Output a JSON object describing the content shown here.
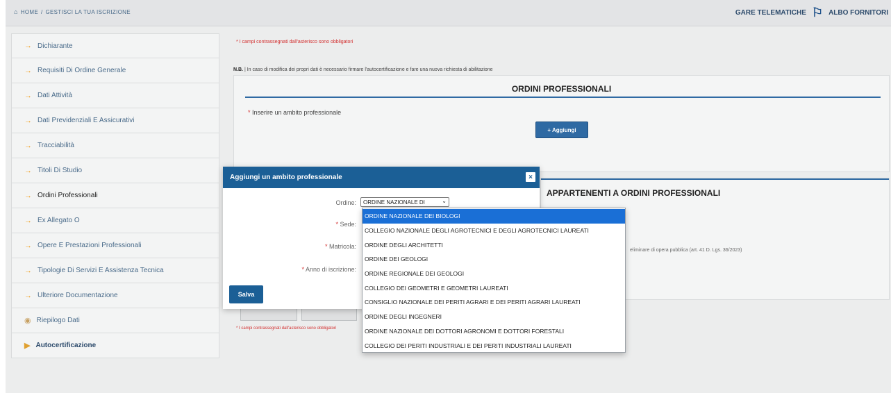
{
  "breadcrumb": {
    "home": "HOME",
    "separator": "/",
    "current": "GESTISCI LA TUA ISCRIZIONE"
  },
  "top_links": {
    "gare": "GARE TELEMATICHE",
    "albo": "ALBO FORNITORI"
  },
  "sidebar": {
    "items": [
      {
        "label": "Dichiarante"
      },
      {
        "label": "Requisiti Di Ordine Generale"
      },
      {
        "label": "Dati Attività"
      },
      {
        "label": "Dati Previdenziali E Assicurativi"
      },
      {
        "label": "Tracciabilità"
      },
      {
        "label": "Titoli Di Studio"
      },
      {
        "label": "Ordini Professionali"
      },
      {
        "label": "Ex Allegato O"
      },
      {
        "label": "Opere E Prestazioni Professionali"
      },
      {
        "label": "Tipologie Di Servizi E Assistenza Tecnica"
      },
      {
        "label": "Ulteriore Documentazione"
      },
      {
        "label": "Riepilogo Dati"
      },
      {
        "label": "Autocertificazione"
      }
    ]
  },
  "main": {
    "required_note": "* I campi contrassegnati dall'asterisco sono obbligatori",
    "nb_prefix": "N.B.",
    "nb_text": "In caso di modifica dei propri dati è necessario firmare l'autocertificazione e fare una nuova richiesta di abilitazione",
    "panel_title": "ORDINI PROFESSIONALI",
    "panel_label": "Inserire un ambito professionale",
    "add_button": "+ Aggiungi",
    "panel2_title": "APPARTENENTI A ORDINI PROFESSIONALI",
    "panel2_text": "eliminare di opera pubblica (art. 41 D. Lgs. 36/2023)",
    "bottom_note": "* I campi contrassegnati dall'asterisco sono obbligatori"
  },
  "modal": {
    "title": "Aggiungi un ambito professionale",
    "close": "×",
    "fields": {
      "ordine": "Ordine:",
      "sede": "Sede:",
      "matricola": "Matricola:",
      "anno": "Anno di iscrizione:"
    },
    "selected_value": "ORDINE NAZIONALE DI",
    "save": "Salva"
  },
  "dropdown": {
    "options": [
      "ORDINE NAZIONALE DEI BIOLOGI",
      "COLLEGIO NAZIONALE DEGLI AGROTECNICI E DEGLI AGROTECNICI LAUREATI",
      "ORDINE DEGLI ARCHITETTI",
      "ORDINE DEI GEOLOGI",
      "ORDINE REGIONALE DEI GEOLOGI",
      "COLLEGIO DEI GEOMETRI E GEOMETRI LAUREATI",
      "CONSIGLIO NAZIONALE DEI PERITI AGRARI E DEI PERITI AGRARI LAUREATI",
      "ORDINE DEGLI INGEGNERI",
      "ORDINE NAZIONALE DEI DOTTORI AGRONOMI E DOTTORI FORESTALI",
      "COLLEGIO DEI PERITI INDUSTRIALI E DEI PERITI INDUSTRIALI LAUREATI"
    ],
    "selected_index": 0
  },
  "colors": {
    "primary": "#1b5f96",
    "accent_arrow": "#f0a020",
    "required_red": "#d32f2f",
    "selected_option": "#1a6fd6"
  }
}
